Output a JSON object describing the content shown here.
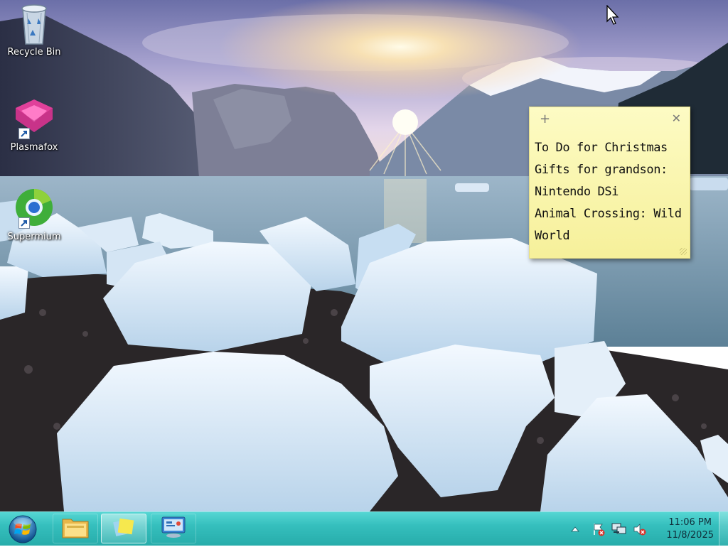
{
  "desktop": {
    "wallpaper": "glacier-lake-sunset",
    "icons": [
      {
        "label": "Recycle Bin",
        "icon": "recycle-bin-icon"
      },
      {
        "label": "Plasmafox",
        "icon": "plasmafox-icon"
      },
      {
        "label": "Supermium",
        "icon": "supermium-icon"
      }
    ]
  },
  "sticky_note": {
    "add_symbol": "+",
    "close_symbol": "✕",
    "lines": [
      "To Do for Christmas",
      "Gifts for grandson:",
      "Nintendo DSi",
      "Animal Crossing: Wild",
      "World"
    ],
    "color": "#f8f3a6"
  },
  "taskbar": {
    "start_icon": "windows-start-orb-icon",
    "buttons": [
      {
        "icon": "file-explorer-icon",
        "state": "pinned"
      },
      {
        "icon": "sticky-notes-icon",
        "state": "active"
      },
      {
        "icon": "control-panel-icon",
        "state": "pinned"
      }
    ],
    "tray": {
      "icons": [
        "show-hidden-icons-arrow-icon",
        "action-center-flag-icon",
        "network-icon",
        "volume-muted-icon"
      ],
      "time": "11:06 PM",
      "date": "11/8/2025"
    },
    "color": "#35bfbd"
  }
}
